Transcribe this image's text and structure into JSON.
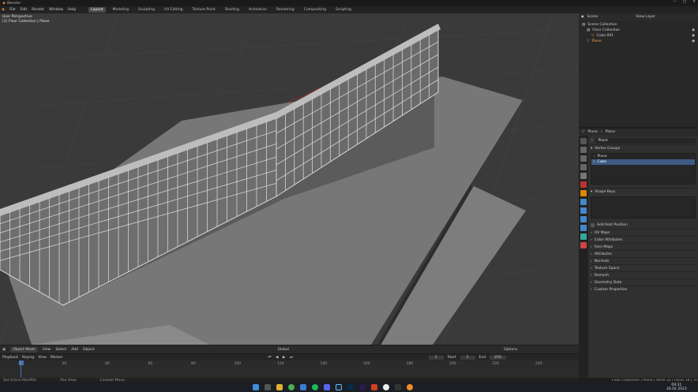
{
  "title_bar": {
    "app_title": "Blender"
  },
  "menus": [
    "File",
    "Edit",
    "Render",
    "Window",
    "Help"
  ],
  "workspaces": [
    "Layout",
    "Modeling",
    "Sculpting",
    "UV Editing",
    "Texture Paint",
    "Shading",
    "Animation",
    "Rendering",
    "Compositing",
    "Scripting"
  ],
  "viewport": {
    "view_name": "User Perspective",
    "object_info": "(1) Floor Collection | Plane",
    "mode": "Object Mode",
    "menu": [
      "View",
      "Select",
      "Add",
      "Object"
    ],
    "transform": "Global",
    "options": "Options"
  },
  "timeline": {
    "playback": "Playback",
    "keying": "Keying",
    "view": "View",
    "marker": "Marker",
    "current_frame": "1",
    "start_label": "Start",
    "start": "1",
    "end_label": "End",
    "end": "250",
    "ticks": [
      "0",
      "20",
      "40",
      "60",
      "80",
      "100",
      "120",
      "140",
      "160",
      "180",
      "200",
      "220",
      "240"
    ]
  },
  "status": [
    "Set Active Modifier",
    "Pan View",
    "Context Menu"
  ],
  "outliner": {
    "scene_label": "Scene",
    "view_layer": "View Layer",
    "items": [
      "Scene Collection",
      "Floor Collection",
      "Cube.001",
      "Plane"
    ]
  },
  "properties": {
    "breadcrumb_object": "Plane",
    "breadcrumb_data": "Plane",
    "mesh_name": "Plane",
    "vertex_groups_title": "Vertex Groups",
    "vertex_groups": [
      "Plane",
      "Cube"
    ],
    "shape_keys_title": "Shape Keys",
    "add_rest_position": "Add Rest Position",
    "sections": [
      "UV Maps",
      "Color Attributes",
      "Face Maps",
      "Attributes",
      "Normals",
      "Texture Space",
      "Remesh",
      "Geometry Data",
      "Custom Properties"
    ]
  },
  "status_right": "Floor Collection | Plane | Verts 32 | Faces 16 | Tris 32 | Objects 0/2 | 3.4.1",
  "clock": {
    "time": "09:31",
    "date": "26.02.2023"
  }
}
